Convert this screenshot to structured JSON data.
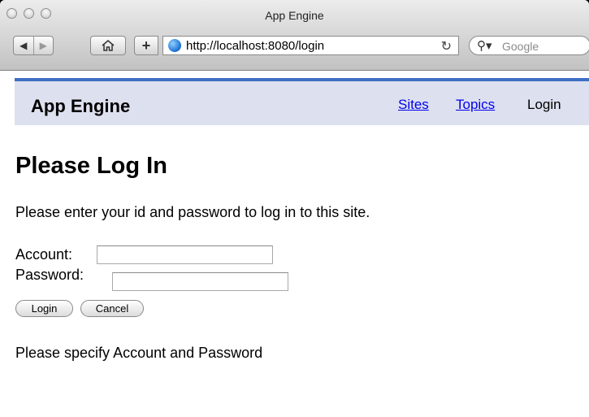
{
  "window": {
    "title": "App Engine"
  },
  "toolbar": {
    "url": "http://localhost:8080/login",
    "search_placeholder": "Google"
  },
  "header": {
    "site_title": "App Engine",
    "nav": [
      {
        "label": "Sites",
        "link": true
      },
      {
        "label": "Topics",
        "link": true
      },
      {
        "label": "Login",
        "link": false
      }
    ]
  },
  "main": {
    "heading": "Please Log In",
    "intro": "Please enter your id and password to log in to this site.",
    "form": {
      "account_label": "Account:",
      "password_label": "Password:",
      "login_button": "Login",
      "cancel_button": "Cancel"
    },
    "message": "Please specify Account and Password"
  },
  "colors": {
    "header_bg": "#dde0ee",
    "header_accent": "#3d6fc4",
    "link": "#0000ee"
  },
  "icons": [
    "close-icon",
    "minimize-icon",
    "zoom-icon",
    "back-icon",
    "forward-icon",
    "home-icon",
    "add-bookmark-icon",
    "globe-icon",
    "reload-icon",
    "search-icon"
  ]
}
